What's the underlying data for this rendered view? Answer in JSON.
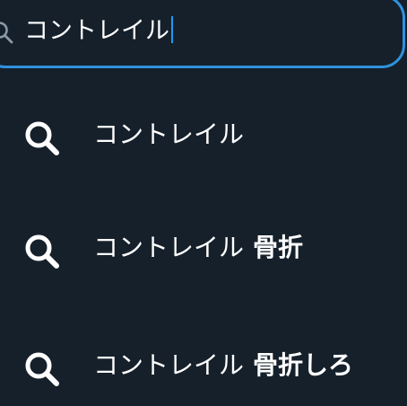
{
  "search": {
    "value": "コントレイル",
    "icon": "search-icon"
  },
  "suggestions": [
    {
      "typed": "コントレイル",
      "completion": "",
      "icon": "search-icon"
    },
    {
      "typed": "コントレイル",
      "completion": "骨折",
      "icon": "search-icon"
    },
    {
      "typed": "コントレイル",
      "completion": "骨折しろ",
      "icon": "search-icon"
    }
  ],
  "colors": {
    "background": "#15202b",
    "accent_border": "#2f92dd",
    "text": "#ffffff",
    "muted_icon": "#8899a6"
  }
}
